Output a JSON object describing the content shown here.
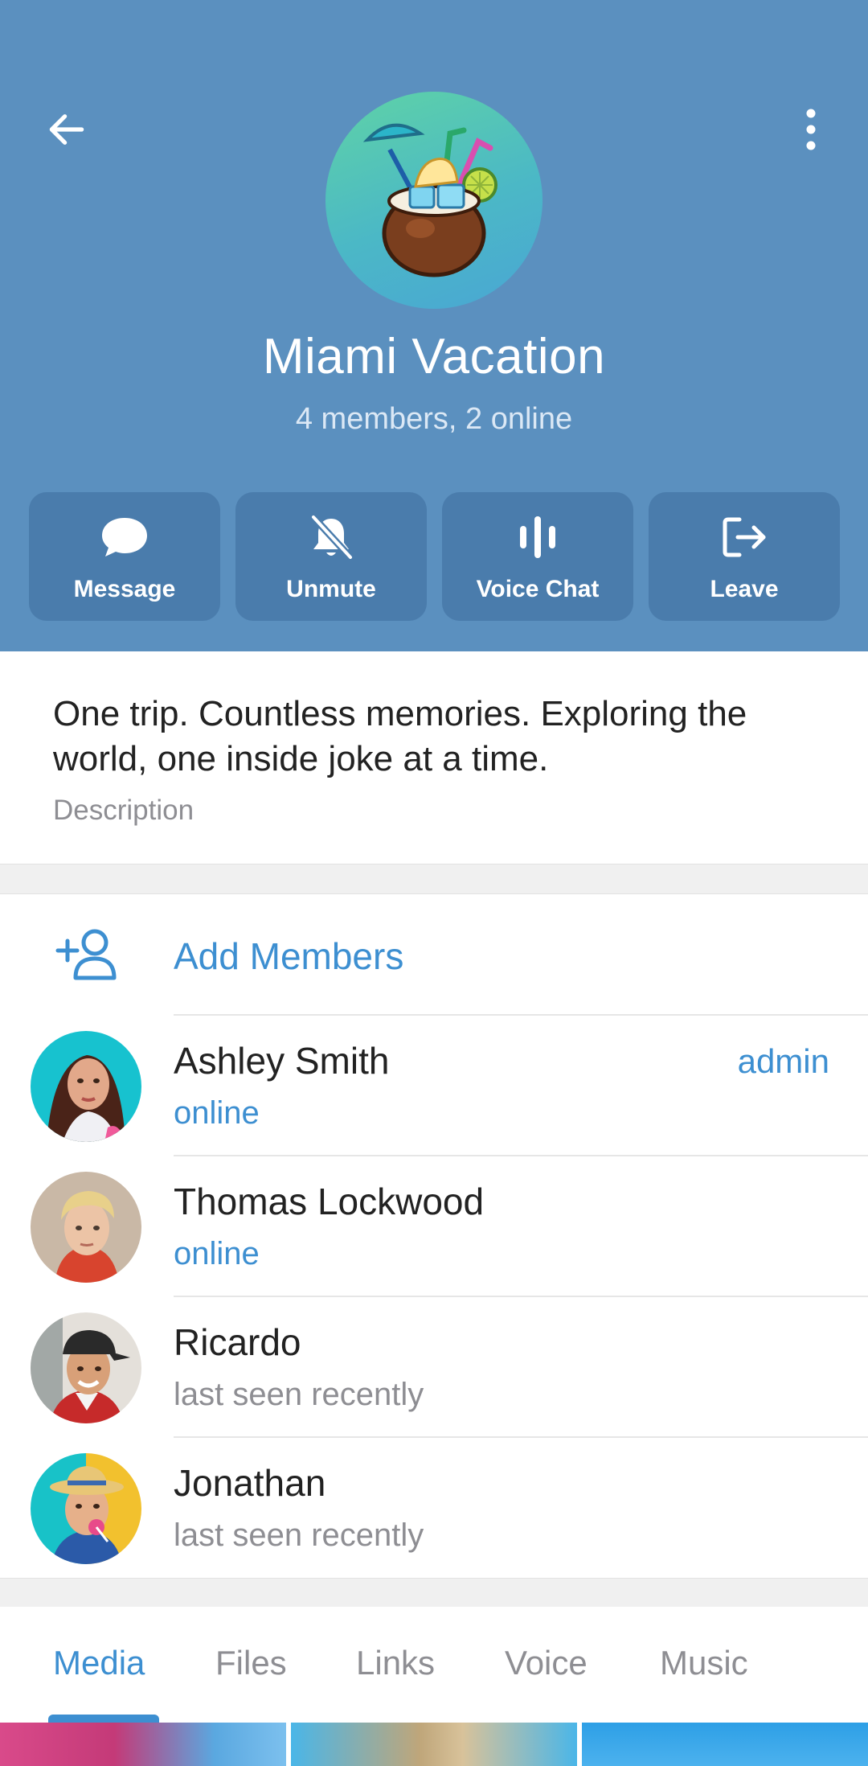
{
  "header": {
    "title": "Miami Vacation",
    "subtitle": "4 members, 2 online",
    "back_icon": "arrow-left-icon",
    "menu_icon": "more-vertical-icon",
    "avatar_icon": "coconut-cocktail-emoji",
    "background_color": "#5b90bf"
  },
  "actions": [
    {
      "label": "Message",
      "icon": "chat-bubble-icon"
    },
    {
      "label": "Unmute",
      "icon": "bell-off-icon"
    },
    {
      "label": "Voice Chat",
      "icon": "voice-bars-icon"
    },
    {
      "label": "Leave",
      "icon": "leave-door-icon"
    }
  ],
  "description": {
    "text": "One trip. Countless memories. Exploring the world, one inside joke at a time.",
    "label": "Description"
  },
  "add_members": {
    "label": "Add Members",
    "icon": "add-person-icon"
  },
  "members": [
    {
      "name": "Ashley Smith",
      "status": "online",
      "role": "admin"
    },
    {
      "name": "Thomas Lockwood",
      "status": "online",
      "role": ""
    },
    {
      "name": "Ricardo",
      "status": "last seen recently",
      "role": ""
    },
    {
      "name": "Jonathan",
      "status": "last seen recently",
      "role": ""
    }
  ],
  "tabs": [
    {
      "label": "Media",
      "active": true
    },
    {
      "label": "Files",
      "active": false
    },
    {
      "label": "Links",
      "active": false
    },
    {
      "label": "Voice",
      "active": false
    },
    {
      "label": "Music",
      "active": false
    }
  ],
  "colors": {
    "accent": "#3d8fd1",
    "header": "#5b90bf",
    "button": "#4a7cac"
  }
}
